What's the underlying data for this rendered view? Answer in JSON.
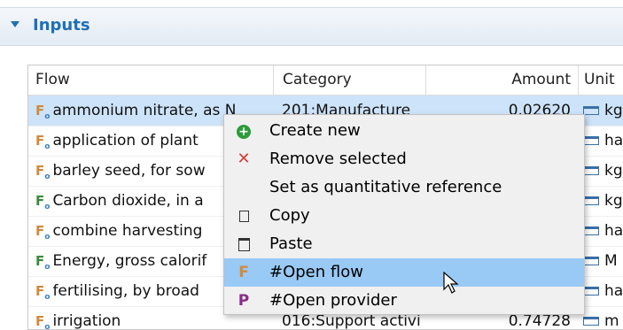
{
  "section": {
    "title": "Inputs"
  },
  "table": {
    "columns": {
      "flow": "Flow",
      "category": "Category",
      "amount": "Amount",
      "unit": "Unit"
    },
    "rows": [
      {
        "flow": "ammonium nitrate, as N",
        "category": "201:Manufacture",
        "amount": "0.02620",
        "unit": "kg"
      },
      {
        "flow": "application of plant",
        "category": "",
        "amount": "",
        "unit": "ha"
      },
      {
        "flow": "barley seed, for sow",
        "category": "",
        "amount": "",
        "unit": "kg"
      },
      {
        "flow": "Carbon dioxide, in a",
        "category": "",
        "amount": "",
        "unit": "kg"
      },
      {
        "flow": "combine harvesting",
        "category": "",
        "amount": "",
        "unit": "ha"
      },
      {
        "flow": "Energy, gross calorif",
        "category": "",
        "amount": "",
        "unit": "M"
      },
      {
        "flow": "fertilising, by broad",
        "category": "",
        "amount": "",
        "unit": "ha"
      },
      {
        "flow": "irrigation",
        "category": "016:Support activi",
        "amount": "0.74728",
        "unit": "m"
      }
    ]
  },
  "context_menu": {
    "items": [
      {
        "label": "Create new",
        "icon": "plus-circle-icon"
      },
      {
        "label": "Remove selected",
        "icon": "x-icon"
      },
      {
        "label": "Set as quantitative reference",
        "icon": ""
      },
      {
        "label": "Copy",
        "icon": "copy-icon"
      },
      {
        "label": "Paste",
        "icon": "paste-icon"
      },
      {
        "label": "#Open flow",
        "icon": "F"
      },
      {
        "label": "#Open provider",
        "icon": "P"
      }
    ]
  },
  "colors": {
    "accent": "#1f6fb5",
    "selection": "#cde3f9",
    "menu_hover": "#99c9f5"
  }
}
